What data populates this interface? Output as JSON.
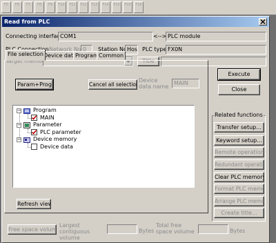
{
  "toolbar": {
    "buttons": [
      "F5",
      "F6",
      "F7",
      "F8",
      "F9",
      "F10",
      "F11",
      "F12",
      "F13",
      "F14",
      "F15",
      "F10",
      "F16"
    ]
  },
  "dialog": {
    "title": "Read from PLC",
    "connecting_interface": {
      "label": "Connecting interface",
      "value": "COM1",
      "arrow": "<-->",
      "target": "PLC module"
    },
    "plc_connection": {
      "label": "PLC Connection",
      "network_no_label": "Network No.",
      "network_no_value": "0",
      "station_no_label": "Station No.",
      "station_no_value": "Host",
      "plc_type_label": "PLC type",
      "plc_type_value": "FX0N"
    },
    "target_memory": {
      "label": "Target memory",
      "value": "",
      "title_button": "Title",
      "title_value": ""
    },
    "tabs": [
      "File selection",
      "Device data",
      "Program",
      "Common"
    ],
    "active_tab": "File selection",
    "param_prog_button": "Param+Prog",
    "cancel_all_button": "Cancel all selections",
    "device_data_name_label": "Device data name",
    "device_data_name_value": "MAIN",
    "tree": {
      "program": {
        "label": "Program",
        "children": [
          {
            "label": "MAIN",
            "checked": true
          }
        ]
      },
      "parameter": {
        "label": "Parameter",
        "children": [
          {
            "label": "PLC parameter",
            "checked": true
          }
        ]
      },
      "device_memory": {
        "label": "Device memory",
        "children": [
          {
            "label": "Device data",
            "checked": false
          }
        ]
      }
    },
    "refresh_button": "Refresh view",
    "execute_button": "Execute",
    "close_button": "Close",
    "related_functions": {
      "label": "Related functions",
      "buttons": [
        {
          "label": "Transfer setup...",
          "enabled": true
        },
        {
          "label": "Keyword setup...",
          "enabled": true
        },
        {
          "label": "Remote operation",
          "enabled": false
        },
        {
          "label": "Redundant operation...",
          "enabled": false
        },
        {
          "label": "Clear PLC memory...",
          "enabled": true
        },
        {
          "label": "Format PLC memory...",
          "enabled": false
        },
        {
          "label": "Arrange PLC memory...",
          "enabled": false
        },
        {
          "label": "Create title...",
          "enabled": false
        }
      ]
    },
    "footer": {
      "free_space_button": "Free space volume",
      "largest_label": "Largest contiguous volume",
      "largest_unit": "Bytes",
      "total_label": "Total free space volume",
      "total_unit": "Bytes"
    }
  }
}
